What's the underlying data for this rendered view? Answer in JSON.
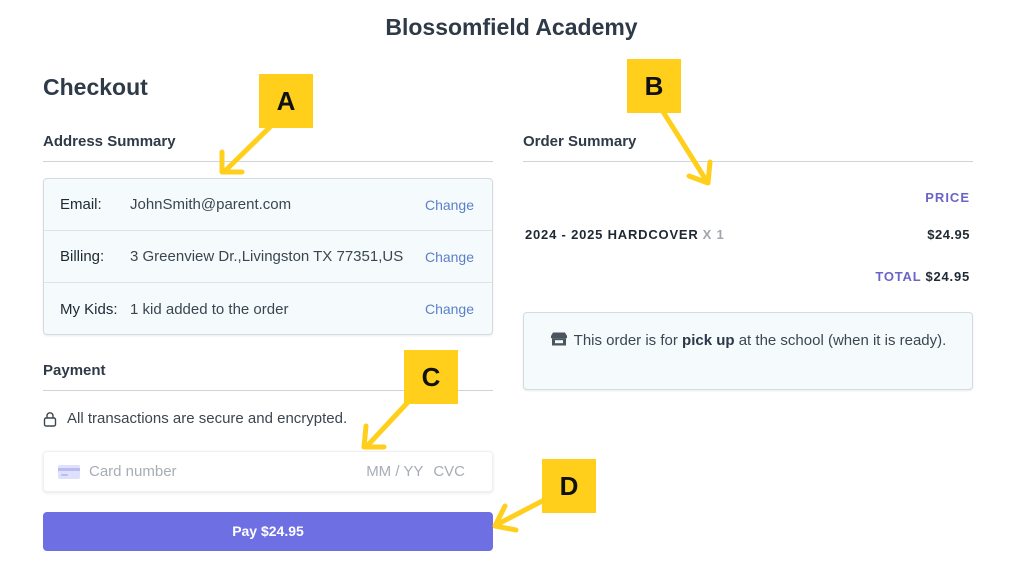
{
  "school_name": "Blossomfield Academy",
  "page_title": "Checkout",
  "address_summary": {
    "title": "Address Summary",
    "rows": [
      {
        "label": "Email:",
        "value": "JohnSmith@parent.com",
        "action": "Change"
      },
      {
        "label": "Billing:",
        "value": "3 Greenview Dr.,Livingston TX 77351,US",
        "action": "Change"
      },
      {
        "label": "My Kids:",
        "value": "1 kid added to the order",
        "action": "Change"
      }
    ]
  },
  "payment": {
    "title": "Payment",
    "secure_note": "All transactions are secure and encrypted.",
    "card_placeholder": "Card number",
    "expiry_placeholder": "MM / YY",
    "cvc_placeholder": "CVC",
    "pay_button_label": "Pay $24.95"
  },
  "order_summary": {
    "title": "Order Summary",
    "price_header": "PRICE",
    "items": [
      {
        "name": "2024 - 2025 HARDCOVER",
        "qty": "X 1",
        "price": "$24.95"
      }
    ],
    "total_label": "TOTAL",
    "total_value": "$24.95",
    "pickup_note_before": "This order is for",
    "pickup_note_bold": "pick up",
    "pickup_note_after": "at the school (when it is ready)."
  },
  "annotations": [
    "A",
    "B",
    "C",
    "D"
  ],
  "colors": {
    "accent": "#6e6fe3",
    "link": "#5b7fc7",
    "card_bg": "#f5fbfd",
    "marker": "#ffcf1b"
  },
  "icons": [
    "lock-icon",
    "credit-card-icon",
    "store-icon"
  ]
}
